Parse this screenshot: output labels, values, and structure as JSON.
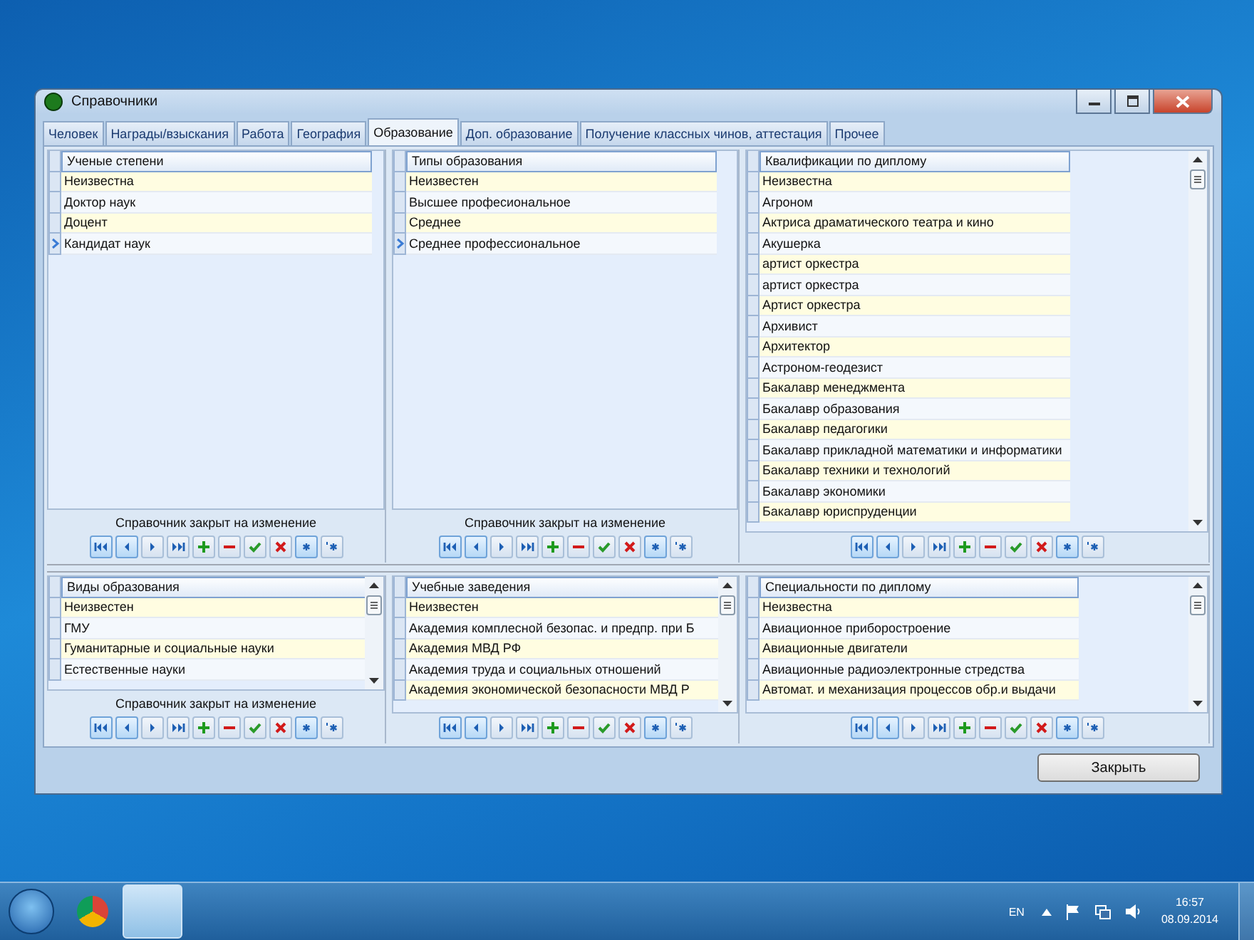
{
  "window": {
    "title": "Справочники"
  },
  "tabs": [
    {
      "label": "Человек",
      "selected": false
    },
    {
      "label": "Награды/взыскания",
      "selected": false
    },
    {
      "label": "Работа",
      "selected": false
    },
    {
      "label": "География",
      "selected": false
    },
    {
      "label": "Образование",
      "selected": true
    },
    {
      "label": "Доп. образование",
      "selected": false
    },
    {
      "label": "Получение классных чинов, аттестация",
      "selected": false
    },
    {
      "label": "Прочее",
      "selected": false
    }
  ],
  "navigator_buttons": [
    {
      "kind": "first",
      "highlighted": true
    },
    {
      "kind": "prior",
      "highlighted": true
    },
    {
      "kind": "next",
      "highlighted": false
    },
    {
      "kind": "last",
      "highlighted": false
    },
    {
      "kind": "insert",
      "highlighted": false
    },
    {
      "kind": "delete",
      "highlighted": false
    },
    {
      "kind": "post",
      "highlighted": false
    },
    {
      "kind": "cancel",
      "highlighted": false
    },
    {
      "kind": "refresh",
      "highlighted": true
    },
    {
      "kind": "filter",
      "highlighted": false
    }
  ],
  "top_panels": [
    {
      "column": "Ученые степени",
      "scrollbar": false,
      "status": "Справочник закрыт на изменение",
      "rows": [
        {
          "text": "Неизвестна",
          "selected": false
        },
        {
          "text": "Доктор наук",
          "selected": false
        },
        {
          "text": "Доцент",
          "selected": false
        },
        {
          "text": "Кандидат наук",
          "selected": true
        }
      ]
    },
    {
      "column": "Типы образования",
      "scrollbar": false,
      "status": "Справочник закрыт на изменение",
      "rows": [
        {
          "text": "Неизвестен",
          "selected": false
        },
        {
          "text": "Высшее професиональное",
          "selected": false
        },
        {
          "text": "Среднее",
          "selected": false
        },
        {
          "text": "Среднее профессиональное",
          "selected": true
        }
      ]
    },
    {
      "column": "Квалификации по диплому",
      "scrollbar": true,
      "rows": [
        {
          "text": "Неизвестна",
          "selected": false
        },
        {
          "text": "Агроном",
          "selected": false
        },
        {
          "text": "Актриса драматического театра и кино",
          "selected": false
        },
        {
          "text": "Акушерка",
          "selected": false
        },
        {
          "text": "артист оркестра",
          "selected": false
        },
        {
          "text": "артист оркестра",
          "selected": false
        },
        {
          "text": "Артист оркестра",
          "selected": false
        },
        {
          "text": "Архивист",
          "selected": false
        },
        {
          "text": "Архитектор",
          "selected": false
        },
        {
          "text": "Астроном-геодезист",
          "selected": false
        },
        {
          "text": "Бакалавр менеджмента",
          "selected": false
        },
        {
          "text": "Бакалавр образования",
          "selected": false
        },
        {
          "text": "Бакалавр педагогики",
          "selected": false
        },
        {
          "text": "Бакалавр прикладной математики и информатики",
          "selected": false
        },
        {
          "text": "Бакалавр техники и технологий",
          "selected": false
        },
        {
          "text": "Бакалавр экономики",
          "selected": false
        },
        {
          "text": "Бакалавр юриспруденции",
          "selected": false
        }
      ]
    }
  ],
  "bottom_panels": [
    {
      "column": "Виды образования",
      "scrollbar": true,
      "status": "Справочник закрыт на изменение",
      "rows": [
        {
          "text": "Неизвестен",
          "selected": false
        },
        {
          "text": "ГМУ",
          "selected": false
        },
        {
          "text": "Гуманитарные и социальные науки",
          "selected": false
        },
        {
          "text": "Естественные науки",
          "selected": false
        }
      ]
    },
    {
      "column": "Учебные заведения",
      "scrollbar": true,
      "rows": [
        {
          "text": "Неизвестен",
          "selected": false
        },
        {
          "text": "Академия комплесной безопас. и предпр. при Б",
          "selected": false
        },
        {
          "text": "Академия МВД РФ",
          "selected": false
        },
        {
          "text": "Академия труда и социальных отношений",
          "selected": false
        },
        {
          "text": "Академия экономической безопасности МВД Р",
          "selected": false
        }
      ]
    },
    {
      "column": "Специальности по диплому",
      "scrollbar": true,
      "rows": [
        {
          "text": "Неизвестна",
          "selected": false
        },
        {
          "text": "Авиационное приборостроение",
          "selected": false
        },
        {
          "text": "Авиационные двигатели",
          "selected": false
        },
        {
          "text": "Авиационные радиоэлектронные стредства",
          "selected": false
        },
        {
          "text": "Автомат. и механизация процессов обр.и выдачи",
          "selected": false
        }
      ]
    }
  ],
  "close_button": "Закрыть",
  "taskbar": {
    "language": "EN",
    "time": "16:57",
    "date": "08.09.2014"
  }
}
